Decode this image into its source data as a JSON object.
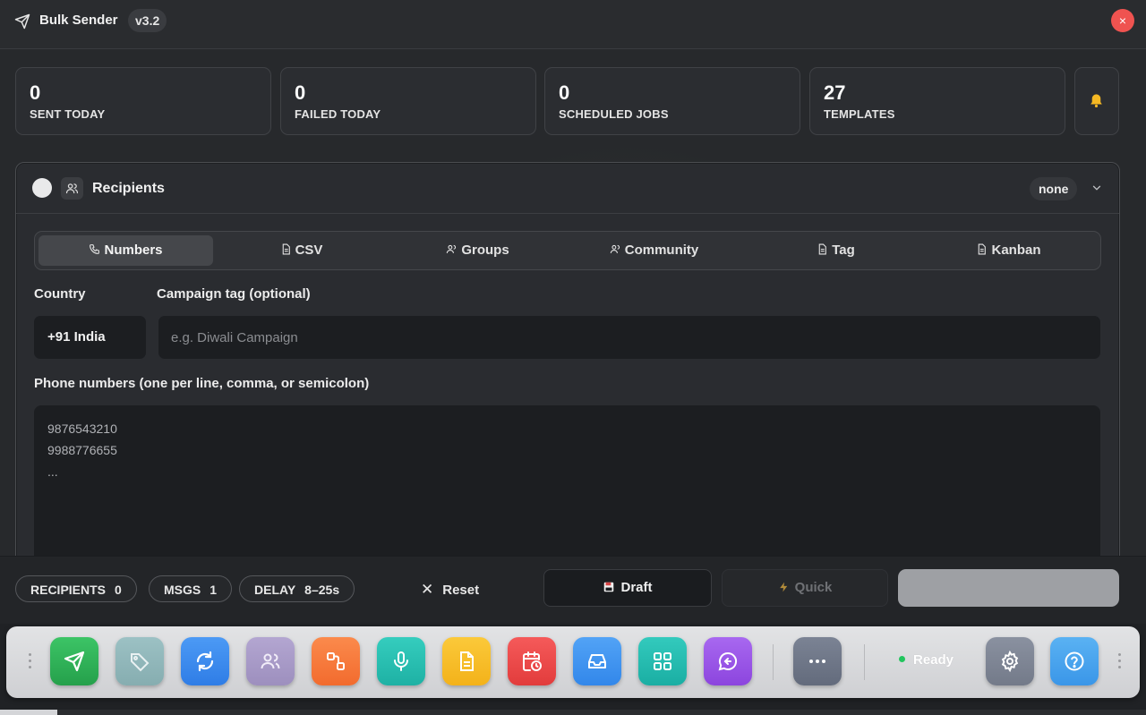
{
  "window": {
    "title": "Bulk Sender",
    "version": "v3.2",
    "close_glyph": "×"
  },
  "stats": [
    {
      "value": "0",
      "label": "SENT TODAY"
    },
    {
      "value": "0",
      "label": "FAILED TODAY"
    },
    {
      "value": "0",
      "label": "SCHEDULED JOBS"
    },
    {
      "value": "27",
      "label": "TEMPLATES"
    }
  ],
  "recipients": {
    "title": "Recipients",
    "selected_filter": "none",
    "tabs": [
      "Numbers",
      "CSV",
      "Groups",
      "Community",
      "Tag",
      "Kanban"
    ],
    "active_tab": "Numbers",
    "country_label": "Country",
    "country_value": "+91 India",
    "campaign_label": "Campaign tag (optional)",
    "campaign_placeholder": "e.g. Diwali Campaign",
    "phones_label": "Phone numbers (one per line, comma, or semicolon)",
    "phones_placeholder": "9876543210\n9988776655\n..."
  },
  "actionbar": {
    "chips": [
      {
        "label": "RECIPIENTS",
        "value": "0"
      },
      {
        "label": "MSGS",
        "value": "1"
      },
      {
        "label": "DELAY",
        "value": "8–25s"
      }
    ],
    "reset_label": "Reset",
    "draft_label": "Draft",
    "quick_label": "Quick"
  },
  "dock": {
    "tiles": [
      {
        "icon": "send-icon",
        "color": "#2fb457"
      },
      {
        "icon": "tag-icon",
        "color": "#8fb5b8"
      },
      {
        "icon": "refresh-icon",
        "color": "#3b8cf0"
      },
      {
        "icon": "users-icon",
        "color": "#a99bc7"
      },
      {
        "icon": "workflow-icon",
        "color": "#f97b3d"
      },
      {
        "icon": "microphone-icon",
        "color": "#26c0b2"
      },
      {
        "icon": "document-icon",
        "color": "#f7bd25"
      },
      {
        "icon": "calendar-clock-icon",
        "color": "#ef4444"
      },
      {
        "icon": "inbox-icon",
        "color": "#4195f1"
      },
      {
        "icon": "grid-icon",
        "color": "#25bdb2"
      },
      {
        "icon": "chat-reply-icon",
        "color": "#9b55e8"
      },
      {
        "icon": "more-icon",
        "color": "#6f7787"
      },
      {
        "icon": "settings-icon",
        "color": "#7d8593"
      },
      {
        "icon": "help-icon",
        "color": "#49a6ee"
      }
    ],
    "status": "Ready",
    "status_color": "#22c55e"
  }
}
